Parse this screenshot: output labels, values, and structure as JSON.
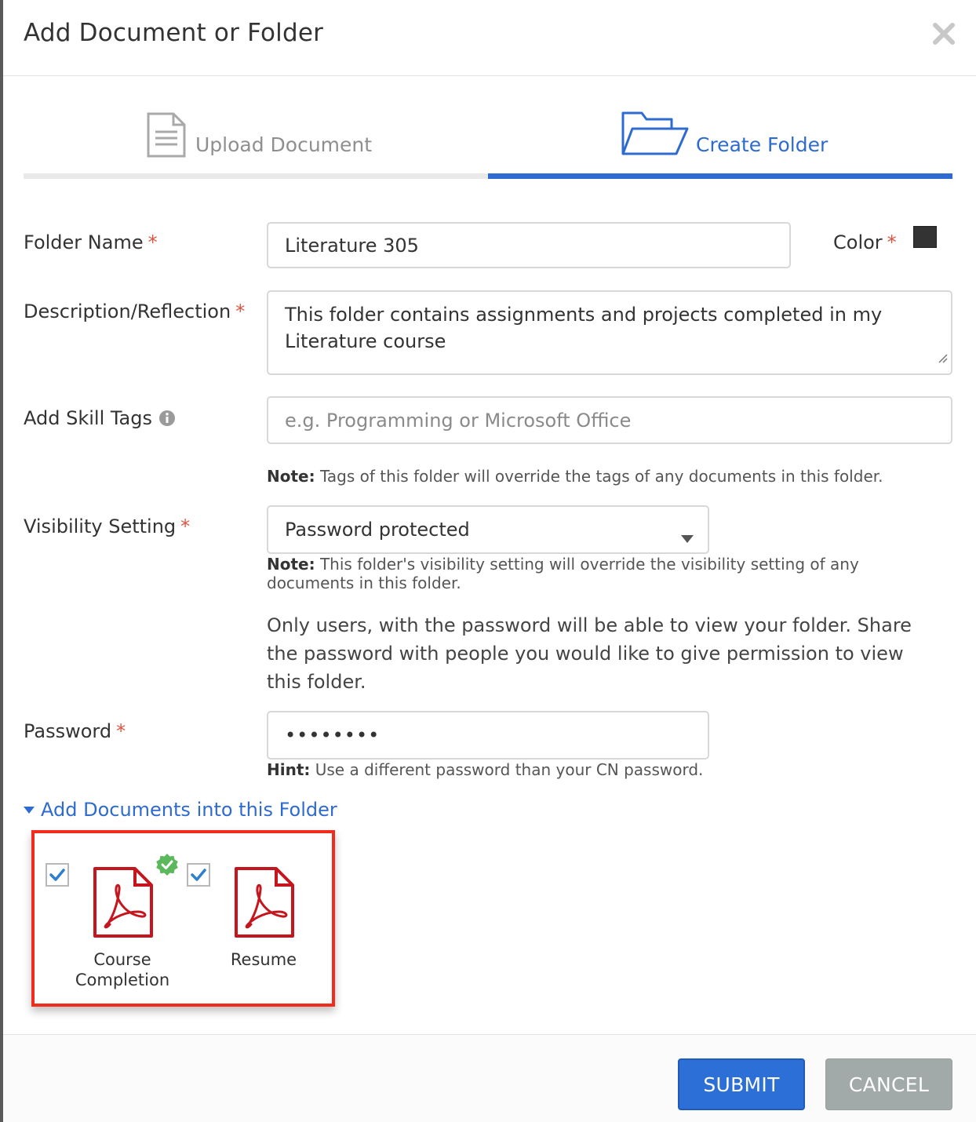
{
  "dialog": {
    "title": "Add Document or Folder"
  },
  "tabs": [
    {
      "label": "Upload Document",
      "icon": "document-icon",
      "active": false
    },
    {
      "label": "Create Folder",
      "icon": "folder-icon",
      "active": true
    }
  ],
  "form": {
    "folder_name": {
      "label": "Folder Name",
      "required_mark": "*",
      "value": "Literature 305"
    },
    "color": {
      "label": "Color",
      "required_mark": "*",
      "value": "#333333"
    },
    "description": {
      "label": "Description/Reflection",
      "required_mark": "*",
      "value": "This folder contains assignments and projects completed in my Literature course"
    },
    "skill_tags": {
      "label": "Add Skill Tags",
      "placeholder": "e.g. Programming or Microsoft Office",
      "note_prefix": "Note:",
      "note": " Tags of this folder will override the tags of any documents in this folder."
    },
    "visibility": {
      "label": "Visibility Setting",
      "required_mark": "*",
      "value": "Password protected",
      "note_prefix": "Note:",
      "note": " This folder's visibility setting will override the visibility setting of any documents in this folder.",
      "info": "Only users, with the password will be able to view your folder. Share the password with people you would like to give permission to view this folder."
    },
    "password": {
      "label": "Password",
      "required_mark": "*",
      "value": "••••••••",
      "hint_prefix": "Hint:",
      "hint": " Use a different password than your CN password."
    }
  },
  "documents_section": {
    "toggle_label": "Add Documents into this Folder",
    "items": [
      {
        "name": "Course Completion",
        "checked": true,
        "verified": true,
        "type": "pdf"
      },
      {
        "name": "Resume",
        "checked": true,
        "verified": false,
        "type": "pdf"
      }
    ]
  },
  "footer": {
    "submit_label": "SUBMIT",
    "cancel_label": "CANCEL"
  },
  "colors": {
    "accent": "#2e6bd0",
    "required": "#e0533f",
    "pdf_red": "#c4161c",
    "highlight_border": "#f12b1d",
    "cancel_gray": "#a2aaa9"
  }
}
